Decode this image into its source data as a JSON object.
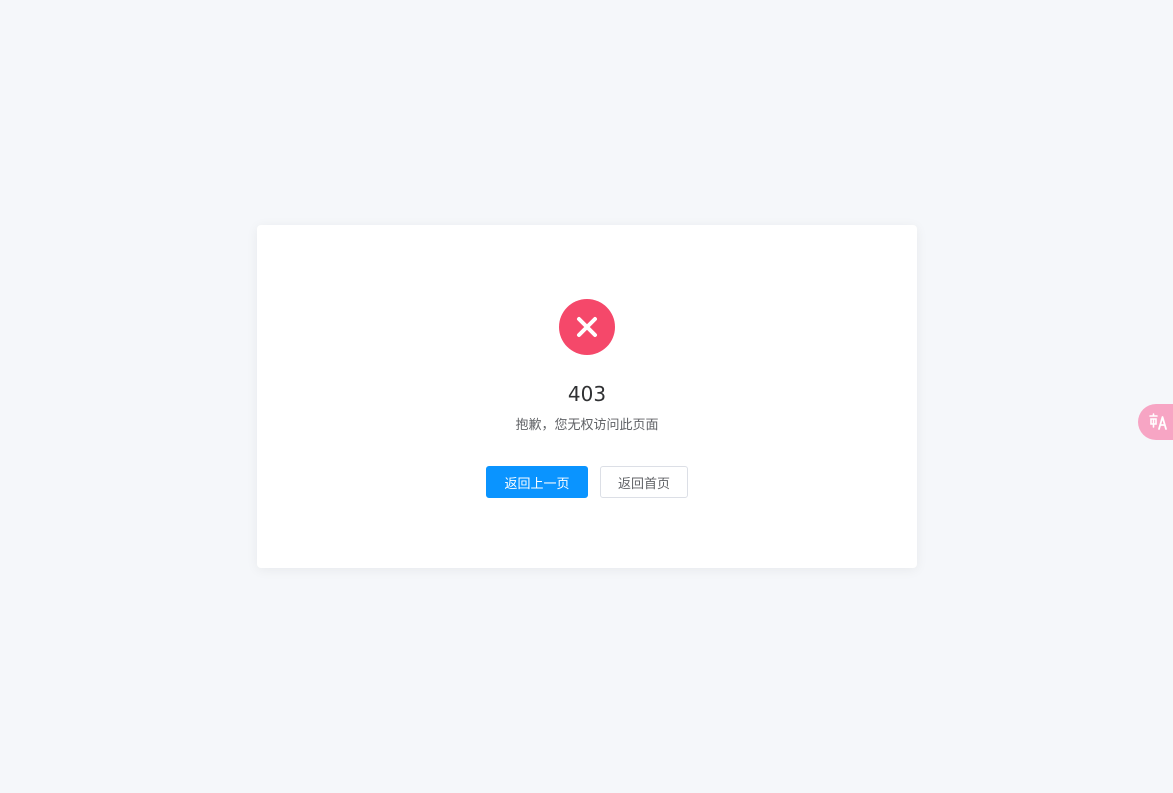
{
  "error": {
    "code": "403",
    "message": "抱歉，您无权访问此页面",
    "icon": "close-circle-icon"
  },
  "actions": {
    "back_label": "返回上一页",
    "home_label": "返回首页"
  },
  "widget": {
    "icon": "translate-icon"
  },
  "colors": {
    "error": "#f5486a",
    "primary": "#0a94ff",
    "background": "#f5f7fa",
    "widget": "#f7a5c4"
  }
}
